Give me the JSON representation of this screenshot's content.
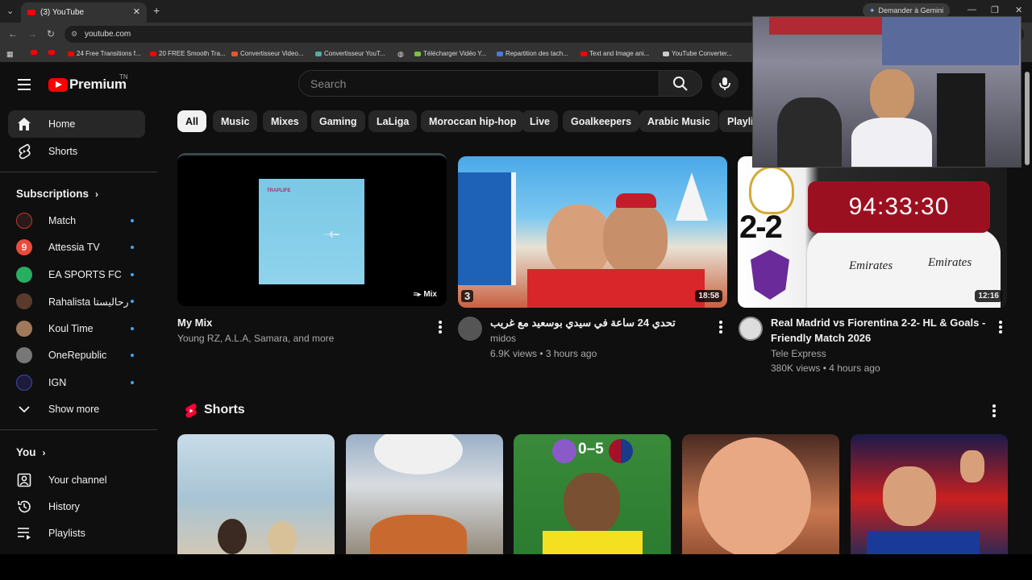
{
  "browser": {
    "tab_title": "(3) YouTube",
    "url": "youtube.com",
    "gemini_label": "Demander à Gemini",
    "bookmarks": [
      "24 Free Transitions f...",
      "20 FREE Smooth Tra...",
      "Convertisseur Video...",
      "Convertisseur YouT...",
      "Télécharger Vidéo Y...",
      "Repartition des tach...",
      "Text and Image ani...",
      "YouTube Converter..."
    ]
  },
  "header": {
    "logo_text": "Premium",
    "logo_sup": "TN",
    "search_placeholder": "Search"
  },
  "sidebar": {
    "main": [
      {
        "label": "Home",
        "icon": "home-icon"
      },
      {
        "label": "Shorts",
        "icon": "shorts-icon"
      }
    ],
    "subscriptions_heading": "Subscriptions",
    "subscriptions": [
      {
        "label": "Match",
        "color": "#c0392b"
      },
      {
        "label": "Attessia TV",
        "color": "#e74c3c"
      },
      {
        "label": "EA SPORTS FC",
        "color": "#27ae60"
      },
      {
        "label": "Rahalista رحاليستا",
        "color": "#8e5a3a"
      },
      {
        "label": "Koul Time",
        "color": "#a0785a"
      },
      {
        "label": "OneRepublic",
        "color": "#777777"
      },
      {
        "label": "IGN",
        "color": "#2a3a9a"
      }
    ],
    "show_more": "Show more",
    "you_heading": "You",
    "you_items": [
      {
        "label": "Your channel",
        "icon": "user-box-icon"
      },
      {
        "label": "History",
        "icon": "history-icon"
      },
      {
        "label": "Playlists",
        "icon": "playlists-icon"
      }
    ]
  },
  "chips": [
    "All",
    "Music",
    "Mixes",
    "Gaming",
    "LaLiga",
    "Moroccan hip-hop",
    "Live",
    "Goalkeepers",
    "Arabic Music",
    "Playlis"
  ],
  "videos": [
    {
      "title": "My Mix",
      "meta": "Young RZ, A.L.A, Samara, and more",
      "badge": "Mix",
      "thumb_text": "TRAPLIFE"
    },
    {
      "title": "تحدي 24 ساعة في سيدي بوسعيد مع غريب",
      "channel": "midos",
      "stats": "6.9K views • 3 hours ago",
      "duration": "18:58",
      "rank": "3"
    },
    {
      "title": "Real Madrid vs Fiorentina 2-2- HL & Goals - Friendly Match 2026",
      "channel": "Tele Express",
      "stats": "380K views • 4 hours ago",
      "duration": "12:16",
      "overlay_timer": "94:33:30",
      "score": "2-2"
    }
  ],
  "shorts": {
    "heading": "Shorts",
    "score_overlay": "0–5"
  },
  "colors": {
    "brand": "#ff0000",
    "background": "#0f0f0f",
    "accent_blue": "#3ea6ff"
  }
}
